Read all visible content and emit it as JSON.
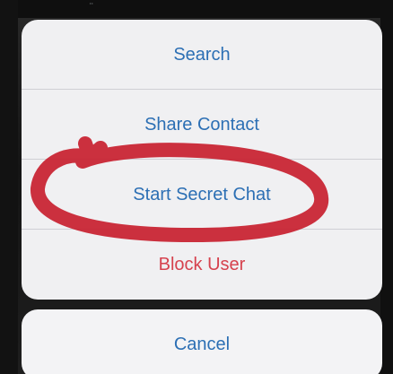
{
  "action_sheet": {
    "items": [
      {
        "label": "Search",
        "style": "default"
      },
      {
        "label": "Share Contact",
        "style": "default"
      },
      {
        "label": "Start Secret Chat",
        "style": "default"
      },
      {
        "label": "Block User",
        "style": "destructive"
      }
    ],
    "cancel_label": "Cancel"
  },
  "colors": {
    "action_blue": "#2c6fb4",
    "destructive_red": "#d6424e",
    "annotation_red": "#c8202f",
    "sheet_background": "#f0f0f2"
  },
  "annotation": {
    "shape": "hand-drawn-ellipse",
    "highlights": "Start Secret Chat"
  }
}
